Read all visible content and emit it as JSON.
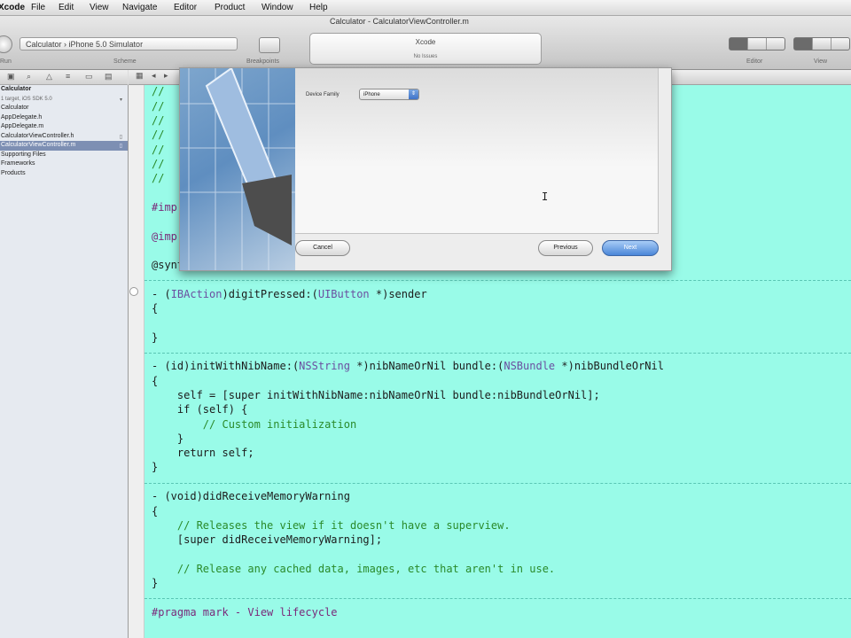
{
  "menubar": {
    "app": "Xcode",
    "items": [
      "File",
      "Edit",
      "View",
      "Navigate",
      "Editor",
      "Product",
      "Window",
      "Help"
    ]
  },
  "window": {
    "title": "Calculator - CalculatorViewController.m"
  },
  "toolbar": {
    "scheme": "Calculator › iPhone 5.0 Simulator",
    "run_label": "Run",
    "scheme_label": "Scheme",
    "breakpoints_label": "Breakpoints",
    "activity_title": "Xcode",
    "activity_status": "No Issues",
    "editor_label": "Editor",
    "view_label": "View"
  },
  "navigator": {
    "items": [
      {
        "label": "Calculator",
        "sub": false,
        "selected": false,
        "badge": ""
      },
      {
        "label": "1 target, iOS SDK 5.0",
        "sub": true,
        "selected": false,
        "badge": ""
      },
      {
        "label": "Calculator",
        "sub": false,
        "selected": false,
        "badge": ""
      },
      {
        "label": "AppDelegate.h",
        "sub": false,
        "selected": false,
        "badge": ""
      },
      {
        "label": "AppDelegate.m",
        "sub": false,
        "selected": false,
        "badge": ""
      },
      {
        "label": "CalculatorViewController.h",
        "sub": false,
        "selected": false,
        "badge": ""
      },
      {
        "label": "CalculatorViewController.m",
        "sub": false,
        "selected": true,
        "badge": ""
      },
      {
        "label": "Supporting Files",
        "sub": false,
        "selected": false,
        "badge": ""
      },
      {
        "label": "Frameworks",
        "sub": false,
        "selected": false,
        "badge": ""
      },
      {
        "label": "Products",
        "sub": false,
        "selected": false,
        "badge": ""
      }
    ]
  },
  "editor": {
    "lines": {
      "c1": "//",
      "c2": "//",
      "c3": "//",
      "c4": "//",
      "c5": "//",
      "c6": "//",
      "c7": "//",
      "imp1": "#imp",
      "imp2": "@imp",
      "synth": "@synthesize display;",
      "dp_a": "- (",
      "dp_type": "IBAction",
      "dp_b": ")digitPressed:(",
      "dp_type2": "UIButton",
      "dp_c": " *)sender",
      "brace_open1": "{",
      "brace_close1": "}",
      "init_a": "- (id)initWithNibName:(",
      "init_type": "NSString",
      "init_b": " *)nibNameOrNil bundle:(",
      "init_type2": "NSBundle",
      "init_c": " *)nibBundleOrNil",
      "brace_open2": "{",
      "self_line": "    self = [super initWithNibName:nibNameOrNil bundle:nibBundleOrNil];",
      "if_line": "    if (self) {",
      "custom_comment": "        // Custom initialization",
      "inner_close": "    }",
      "return_line": "    return self;",
      "brace_close2": "}",
      "mem_a": "- (void)didReceiveMemoryWarning",
      "brace_open3": "{",
      "mem_comment1": "    // Releases the view if it doesn't have a superview.",
      "super_line": "    [super didReceiveMemoryWarning];",
      "mem_comment2": "    // Release any cached data, images, etc that aren't in use.",
      "brace_close3": "}",
      "pragma": "#pragma mark - View lifecycle"
    }
  },
  "sheet": {
    "device_family_label": "Device Family",
    "device_family_value": "iPhone",
    "cancel": "Cancel",
    "previous": "Previous",
    "next": "Next"
  },
  "colors": {
    "editor_bg": "#99fbe8",
    "comment": "#2a8a2a",
    "selection": "#7d8fb3",
    "default_button": "#4a86d8"
  }
}
